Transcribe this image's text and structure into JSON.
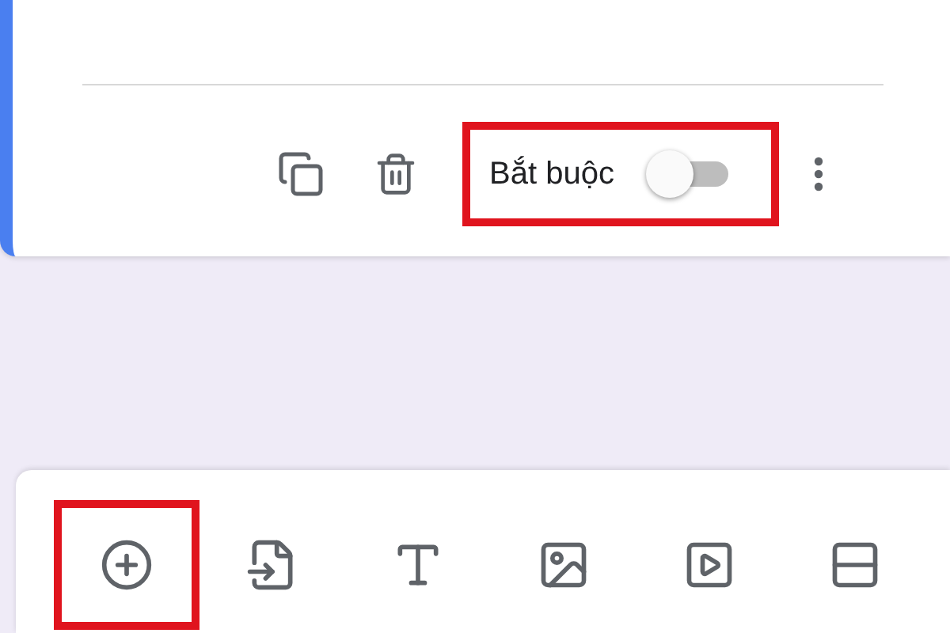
{
  "question_footer": {
    "required_label": "Bắt buộc",
    "required_on": false,
    "highlighted": true
  },
  "toolbar": {
    "items": [
      {
        "kind": "add",
        "highlighted": true
      },
      {
        "kind": "import",
        "highlighted": false
      },
      {
        "kind": "title",
        "highlighted": false
      },
      {
        "kind": "image",
        "highlighted": false
      },
      {
        "kind": "video",
        "highlighted": false
      },
      {
        "kind": "section",
        "highlighted": false
      }
    ]
  }
}
